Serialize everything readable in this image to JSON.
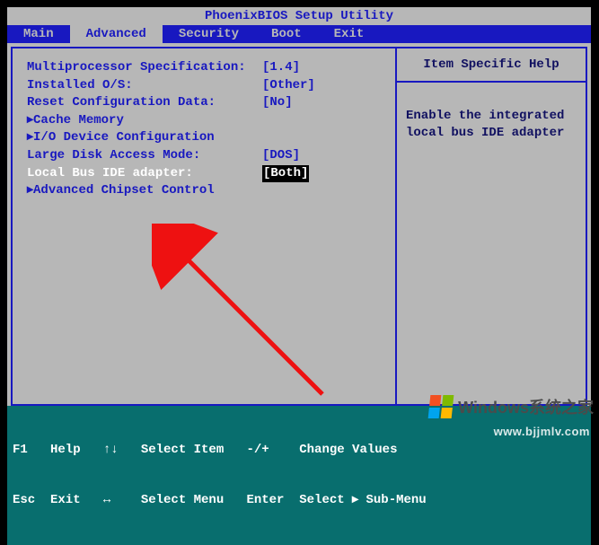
{
  "title": "PhoenixBIOS Setup Utility",
  "menu": {
    "items": [
      "Main",
      "Advanced",
      "Security",
      "Boot",
      "Exit"
    ],
    "active_index": 1
  },
  "settings": [
    {
      "type": "field",
      "label": "Multiprocessor Specification:",
      "value": "[1.4]"
    },
    {
      "type": "field",
      "label": "Installed O/S:",
      "value": "[Other]"
    },
    {
      "type": "field",
      "label": "Reset Configuration Data:",
      "value": "[No]"
    },
    {
      "type": "submenu",
      "label": "Cache Memory"
    },
    {
      "type": "submenu",
      "label": "I/O Device Configuration"
    },
    {
      "type": "field",
      "label": "Large Disk Access Mode:",
      "value": "[DOS]"
    },
    {
      "type": "field",
      "label": "Local Bus IDE adapter:",
      "value": "[Both]",
      "selected": true
    },
    {
      "type": "submenu",
      "label": "Advanced Chipset Control"
    }
  ],
  "help": {
    "title": "Item Specific Help",
    "content": "Enable the integrated local bus IDE adapter"
  },
  "footer": {
    "line1": "F1   Help   ↑↓   Select Item   -/+    Change Values",
    "line2": "Esc  Exit   ↔    Select Menu   Enter  Select ▸ Sub-Menu"
  },
  "watermarks": {
    "brand": "Windows系统之家",
    "url": "www.bjjmlv.com"
  }
}
